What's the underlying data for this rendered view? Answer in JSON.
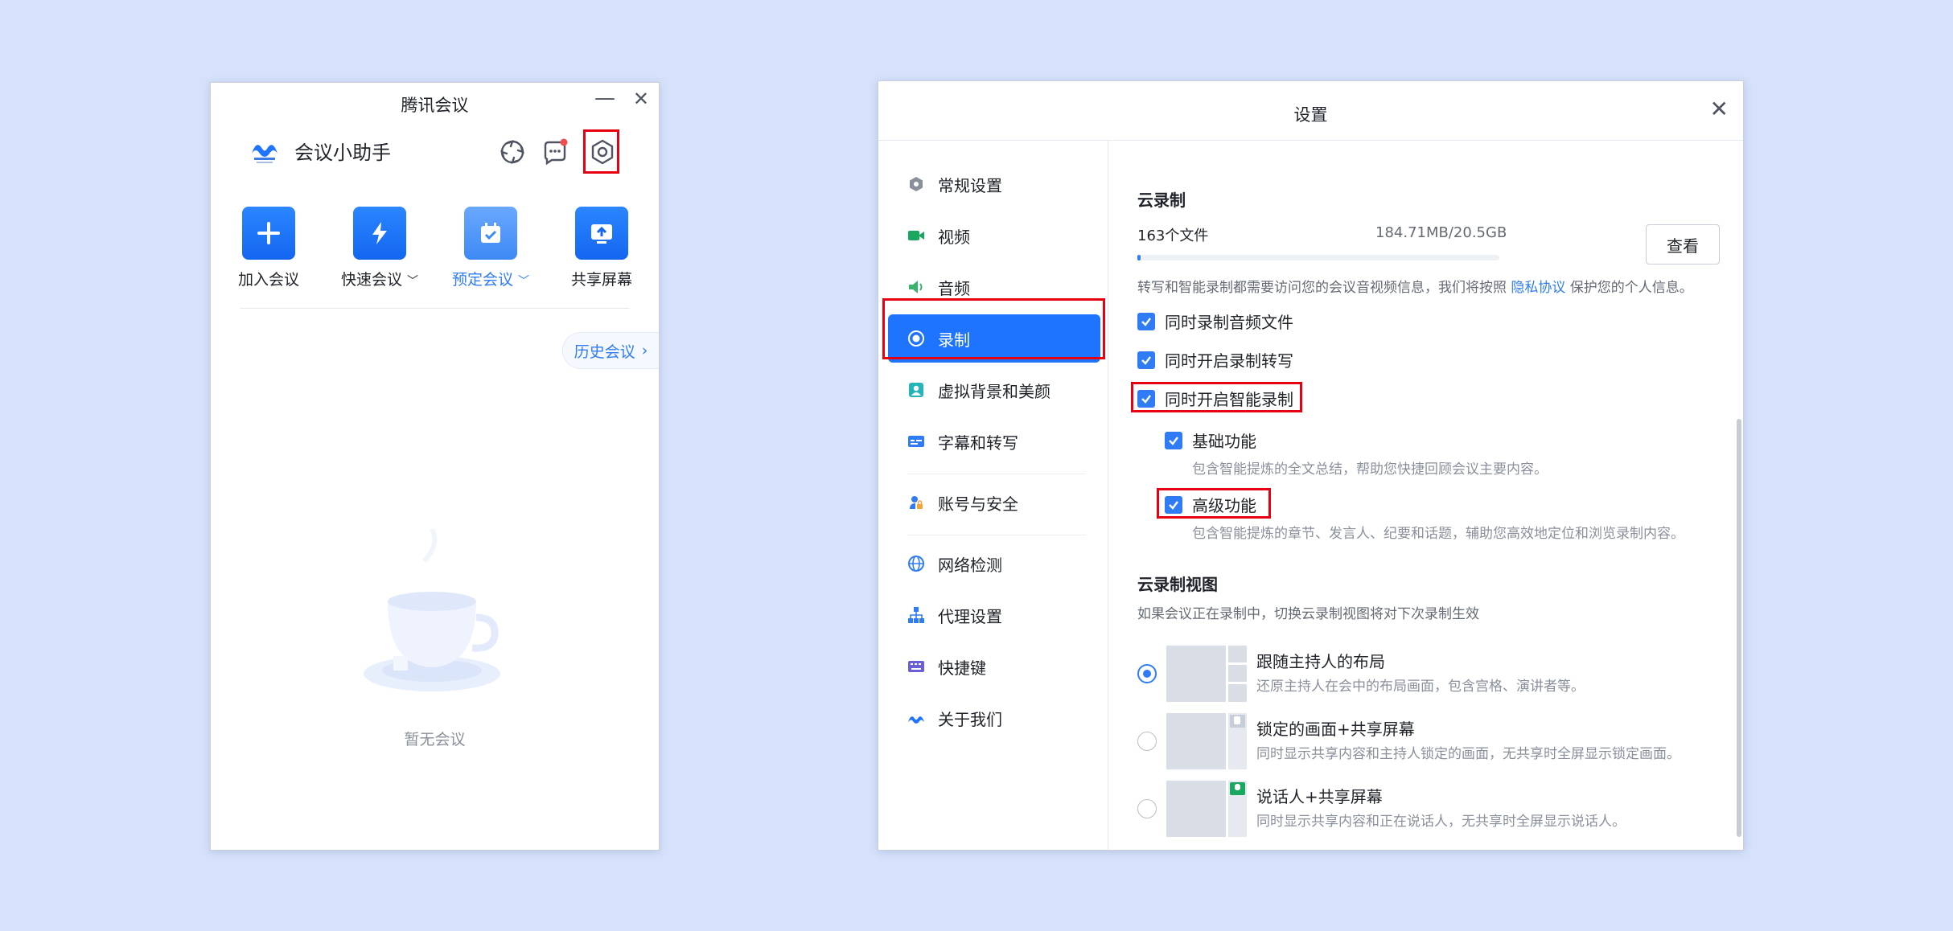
{
  "left_window": {
    "title": "腾讯会议",
    "minimize_glyph": "—",
    "close_glyph": "✕",
    "brand_name": "会议小助手",
    "header_icons": [
      "sync-icon",
      "chat-icon",
      "settings-icon"
    ],
    "actions": [
      {
        "label": "加入会议",
        "icon": "plus-icon",
        "has_dropdown": false
      },
      {
        "label": "快速会议",
        "icon": "lightning-icon",
        "has_dropdown": true
      },
      {
        "label": "预定会议",
        "icon": "calendar-icon",
        "has_dropdown": true
      },
      {
        "label": "共享屏幕",
        "icon": "share-screen-icon",
        "has_dropdown": false
      }
    ],
    "history_label": "历史会议",
    "empty_text": "暂无会议"
  },
  "settings_window": {
    "title": "设置",
    "close_glyph": "✕",
    "nav": [
      {
        "label": "常规设置",
        "icon": "gear-icon"
      },
      {
        "label": "视频",
        "icon": "video-icon"
      },
      {
        "label": "音频",
        "icon": "speaker-icon"
      },
      {
        "label": "录制",
        "icon": "record-icon",
        "active": true
      },
      {
        "label": "虚拟背景和美颜",
        "icon": "portrait-icon"
      },
      {
        "label": "字幕和转写",
        "icon": "caption-icon"
      },
      {
        "label": "账号与安全",
        "icon": "account-lock-icon"
      },
      {
        "label": "网络检测",
        "icon": "globe-icon"
      },
      {
        "label": "代理设置",
        "icon": "network-tree-icon"
      },
      {
        "label": "快捷键",
        "icon": "keyboard-icon"
      },
      {
        "label": "关于我们",
        "icon": "tencent-meeting-logo-icon"
      }
    ],
    "cloud": {
      "section_title": "云录制",
      "files": "163个文件",
      "usage": "184.71MB/20.5GB",
      "usage_fraction": 0.009,
      "view_button": "查看",
      "note_prefix": "转写和智能录制都需要访问您的会议音视频信息，我们将按照",
      "note_link": "隐私协议",
      "note_suffix": "保护您的个人信息。",
      "options": [
        {
          "label": "同时录制音频文件",
          "checked": true
        },
        {
          "label": "同时开启录制转写",
          "checked": true
        },
        {
          "label": "同时开启智能录制",
          "checked": true
        }
      ],
      "sub_options": [
        {
          "label": "基础功能",
          "desc": "包含智能提炼的全文总结，帮助您快捷回顾会议主要内容。",
          "checked": true
        },
        {
          "label": "高级功能",
          "desc": "包含智能提炼的章节、发言人、纪要和话题，辅助您高效地定位和浏览录制内容。",
          "checked": true
        }
      ]
    },
    "view": {
      "section_title": "云录制视图",
      "hint": "如果会议正在录制中，切换云录制视图将对下次录制生效",
      "layouts": [
        {
          "title": "跟随主持人的布局",
          "desc": "还原主持人在会中的布局画面，包含宫格、演讲者等。",
          "selected": true
        },
        {
          "title": "锁定的画面+共享屏幕",
          "desc": "同时显示共享内容和主持人锁定的画面，无共享时全屏显示锁定画面。",
          "selected": false
        },
        {
          "title": "说话人+共享屏幕",
          "desc": "同时显示共享内容和正在说话人，无共享时全屏显示说话人。",
          "selected": false
        }
      ]
    }
  },
  "colors": {
    "accent": "#1e74ff",
    "highlight_box": "#e60012",
    "background": "#d6e2fb"
  }
}
